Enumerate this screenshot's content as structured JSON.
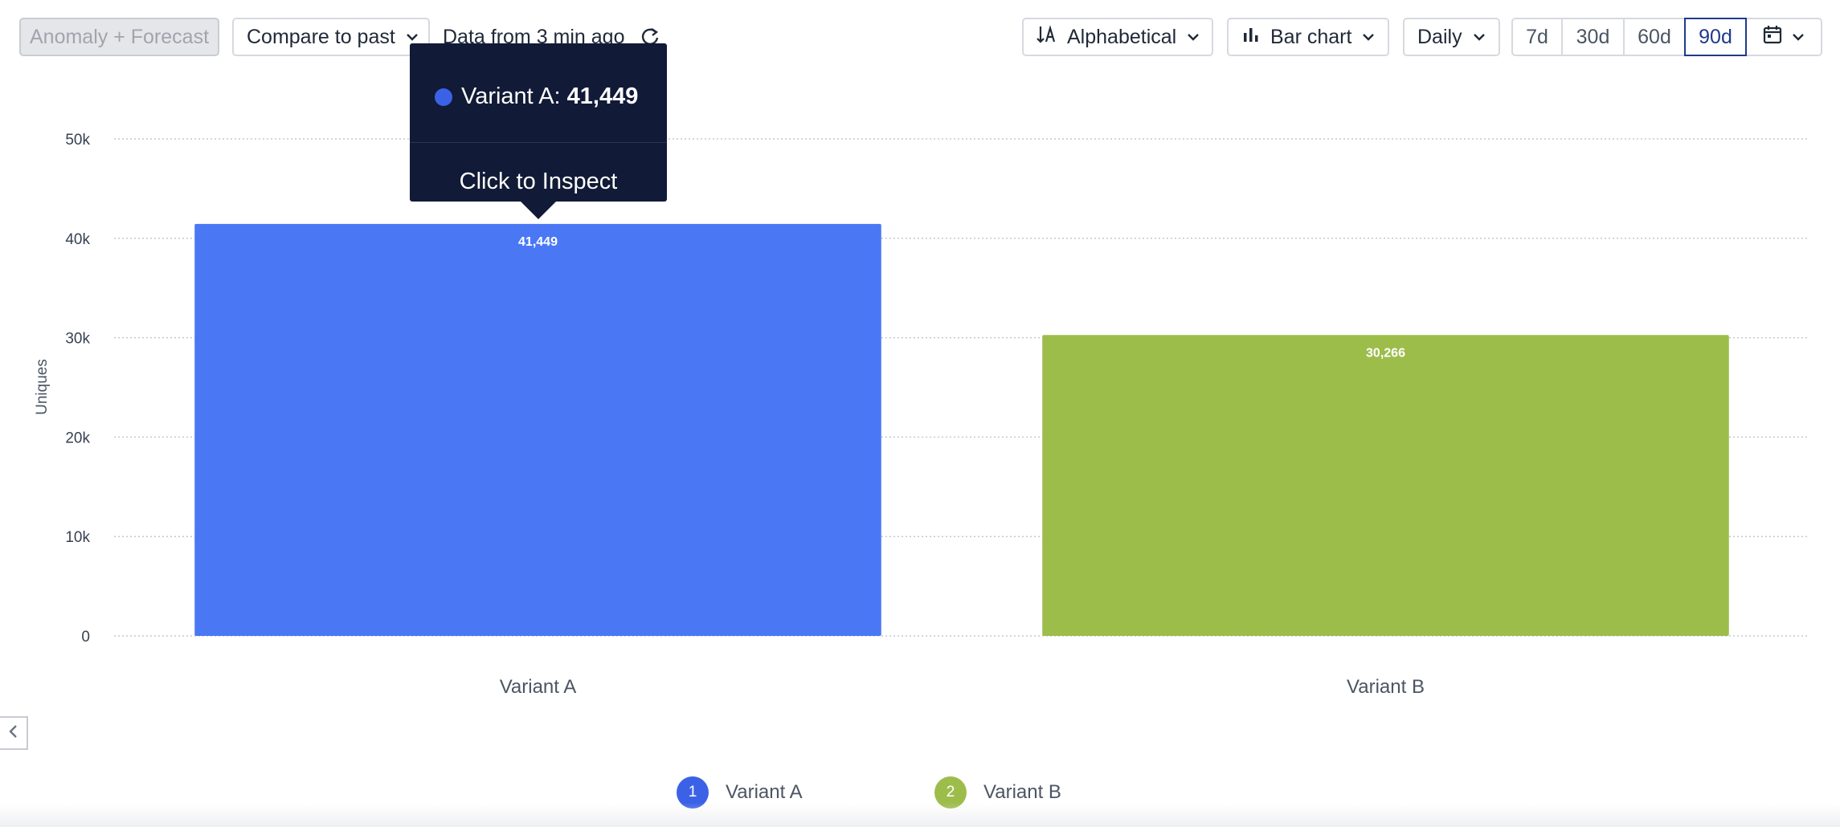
{
  "toolbar": {
    "anomaly_label": "Anomaly + Forecast",
    "compare_label": "Compare to past",
    "data_freshness": "Data from 3 min ago",
    "sort_label": "Alphabetical",
    "chart_type_label": "Bar chart",
    "interval_label": "Daily",
    "ranges": [
      "7d",
      "30d",
      "60d",
      "90d"
    ],
    "active_range": "90d"
  },
  "icons": {
    "refresh": "refresh-icon",
    "sort": "sort-alpha-icon",
    "bar_chart": "bar-chart-icon",
    "calendar": "calendar-icon",
    "chevron": "chevron-down-icon",
    "collapse": "chevron-left-icon"
  },
  "tooltip": {
    "series_name": "Variant A",
    "separator": ": ",
    "value_text": "41,449",
    "action": "Click to Inspect",
    "color": "#3b62e6"
  },
  "chart_data": {
    "type": "bar",
    "categories": [
      "Variant A",
      "Variant B"
    ],
    "values": [
      41449,
      30266
    ],
    "value_labels": [
      "41,449",
      "30,266"
    ],
    "colors": [
      "#4a78f5",
      "#9dbd4b"
    ],
    "ylabel": "Uniques",
    "ylim": [
      0,
      50000
    ],
    "yticks": [
      0,
      10000,
      20000,
      30000,
      40000,
      50000
    ],
    "ytick_labels": [
      "0",
      "10k",
      "20k",
      "30k",
      "40k",
      "50k"
    ],
    "grid": true
  },
  "legend": {
    "items": [
      {
        "index": "1",
        "label": "Variant A",
        "color": "#3b62e6"
      },
      {
        "index": "2",
        "label": "Variant B",
        "color": "#9dbd4b"
      }
    ]
  }
}
